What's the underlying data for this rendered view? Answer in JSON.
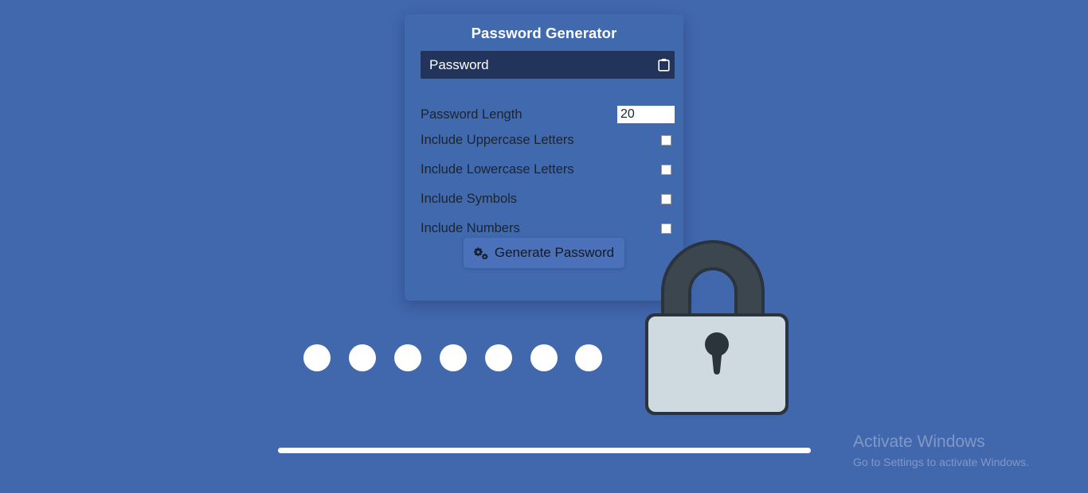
{
  "app": {
    "background_color": "#4167ad",
    "card_color": "#4169ae"
  },
  "card": {
    "title": "Password Generator",
    "password_field": {
      "placeholder": "Password",
      "value": "",
      "background_color": "#22335c",
      "text_color": "#ffffff"
    },
    "copy_button": {
      "icon": "clipboard-icon",
      "label": ""
    },
    "options": [
      {
        "id": "length",
        "label": "Password Length",
        "control": "number-input",
        "value": "20"
      },
      {
        "id": "uppercase",
        "label": "Include Uppercase Letters",
        "control": "checkbox",
        "checked": false
      },
      {
        "id": "lowercase",
        "label": "Include Lowercase Letters",
        "control": "checkbox",
        "checked": false
      },
      {
        "id": "symbols",
        "label": "Include Symbols",
        "control": "checkbox",
        "checked": false
      },
      {
        "id": "numbers",
        "label": "Include Numbers",
        "control": "checkbox",
        "checked": false
      }
    ],
    "generate_button": {
      "label": "Generate Password",
      "icon": "cogs-icon",
      "background_color": "#4a71ba"
    }
  },
  "decoration": {
    "padlock": {
      "icon": "padlock-icon",
      "body_color": "#cfd9e0",
      "shackle_color": "#343d46",
      "keyhole_color": "#2b333c"
    },
    "dots": {
      "count": 7,
      "color": "#ffffff",
      "diameter": 34,
      "spacing": 57
    },
    "bar": {
      "color": "#ffffff"
    }
  },
  "watermark": {
    "title": "Activate Windows",
    "subtitle": "Go to Settings to activate Windows.",
    "color": "#8298c4"
  }
}
